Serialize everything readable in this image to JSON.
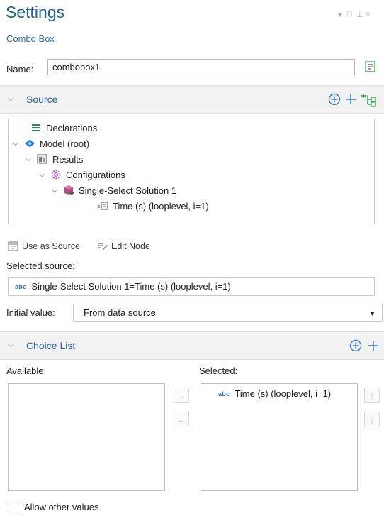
{
  "header": {
    "title": "Settings",
    "subtitle": "Combo Box",
    "window_controls": [
      "▾",
      "□",
      "⊥",
      "×"
    ]
  },
  "name_field": {
    "label": "Name:",
    "value": "combobox1"
  },
  "source": {
    "section_title": "Source",
    "tree": [
      {
        "label": "Declarations",
        "icon": "declarations-icon",
        "level": 0,
        "expanded": null
      },
      {
        "label": "Model (root)",
        "icon": "model-icon",
        "level": 0,
        "expanded": true
      },
      {
        "label": "Results",
        "icon": "results-icon",
        "level": 1,
        "expanded": true
      },
      {
        "label": "Configurations",
        "icon": "configurations-icon",
        "level": 2,
        "expanded": true
      },
      {
        "label": "Single-Select Solution 1",
        "icon": "solution-icon",
        "level": 3,
        "expanded": true
      },
      {
        "label": "Time (s) (looplevel, i=1)",
        "icon": "parameter-icon",
        "level": 4,
        "expanded": null
      }
    ],
    "use_as_source_label": "Use as Source",
    "edit_node_label": "Edit Node",
    "selected_source_label": "Selected source:",
    "selected_source_type": "abc",
    "selected_source_value": "Single-Select Solution 1=Time (s) (looplevel, i=1)"
  },
  "initial_value": {
    "label": "Initial value:",
    "selected": "From data source"
  },
  "choice_list": {
    "section_title": "Choice List",
    "available_label": "Available:",
    "selected_label": "Selected:",
    "available_items": [],
    "selected_items": [
      {
        "type": "abc",
        "label": "Time (s) (looplevel, i=1)"
      }
    ]
  },
  "allow_other_values": {
    "label": "Allow other values",
    "checked": false
  },
  "colors": {
    "accent": "#2a62a0",
    "add_green": "#3f9b56",
    "add_blue": "#3a7fc2"
  }
}
